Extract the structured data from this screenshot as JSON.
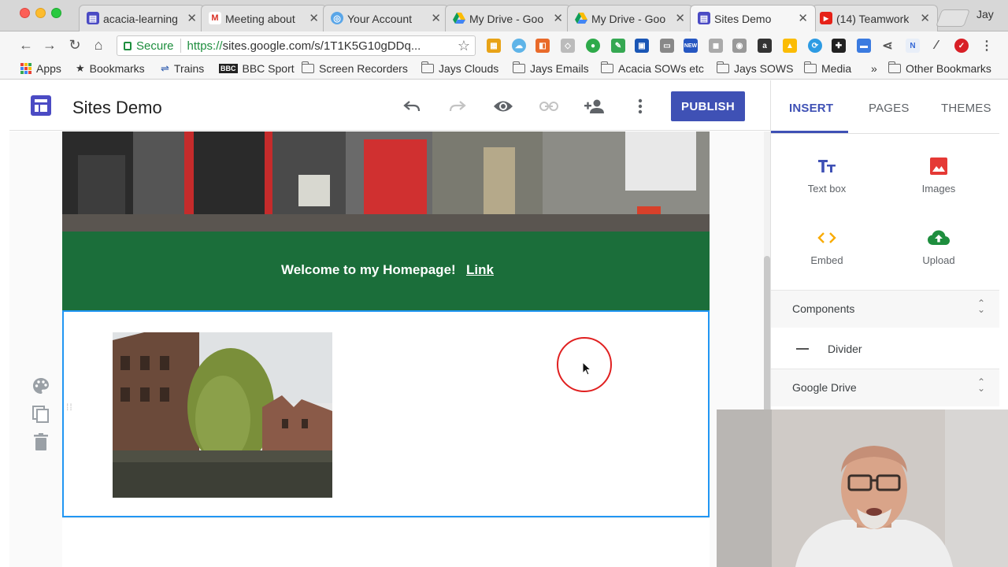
{
  "browser": {
    "tabs": [
      {
        "title": "acacia-learning",
        "fav_color": "#4b4bc4",
        "fav_glyph": "▤",
        "active": false
      },
      {
        "title": "Meeting about",
        "fav_color": "#ffffff",
        "fav_glyph": "M",
        "active": false
      },
      {
        "title": "Your Account",
        "fav_color": "#5aa6e8",
        "fav_glyph": "◎",
        "active": false
      },
      {
        "title": "My Drive - Goo",
        "fav_color": "#ffffff",
        "fav_glyph": "▲",
        "active": false
      },
      {
        "title": "My Drive - Goo",
        "fav_color": "#ffffff",
        "fav_glyph": "▲",
        "active": false
      },
      {
        "title": "Sites Demo",
        "fav_color": "#4b4bc4",
        "fav_glyph": "▤",
        "active": true
      },
      {
        "title": "(14) Teamwork",
        "fav_color": "#e62117",
        "fav_glyph": "▶",
        "active": false
      }
    ],
    "close_glyph": "✕",
    "profile_name": "Jay",
    "address": {
      "secure_label": "Secure",
      "url_prefix": "https://",
      "url_rest": "sites.google.com/s/1T1K5G10gDDq..."
    },
    "bookmarks": [
      {
        "label": "Apps",
        "icon": "apps-grid-icon"
      },
      {
        "label": "Bookmarks",
        "icon": "star-icon"
      },
      {
        "label": "Trains",
        "icon": "rail-icon"
      },
      {
        "label": "BBC Sport",
        "icon": "bbc-icon"
      },
      {
        "label": "Screen Recorders",
        "icon": "folder-icon"
      },
      {
        "label": "Jays Clouds",
        "icon": "folder-icon"
      },
      {
        "label": "Jays Emails",
        "icon": "folder-icon"
      },
      {
        "label": "Acacia SOWs etc",
        "icon": "folder-icon"
      },
      {
        "label": "Jays SOWS",
        "icon": "folder-icon"
      },
      {
        "label": "Media",
        "icon": "folder-icon"
      },
      {
        "label": "»",
        "icon": "overflow-chevron-icon"
      },
      {
        "label": "Other Bookmarks",
        "icon": "folder-icon"
      }
    ]
  },
  "editor": {
    "site_title": "Sites Demo",
    "publish_label": "PUBLISH",
    "accent_color": "#3f51b5",
    "header_icons": [
      "undo-icon",
      "redo-icon",
      "preview-icon",
      "link-icon",
      "share-icon",
      "more-icon"
    ]
  },
  "panel": {
    "tabs": [
      "INSERT",
      "PAGES",
      "THEMES"
    ],
    "active_tab": "INSERT",
    "tools": [
      {
        "label": "Text box",
        "icon": "text-box-icon"
      },
      {
        "label": "Images",
        "icon": "images-icon"
      },
      {
        "label": "Embed",
        "icon": "embed-icon"
      },
      {
        "label": "Upload",
        "icon": "upload-icon"
      }
    ],
    "components_label": "Components",
    "divider_label": "Divider",
    "google_drive_label": "Google Drive"
  },
  "canvas": {
    "banner_text": "Welcome to my Homepage!",
    "banner_link": "Link",
    "banner_color": "#1b6e3a",
    "selection_color": "#2196f3"
  }
}
